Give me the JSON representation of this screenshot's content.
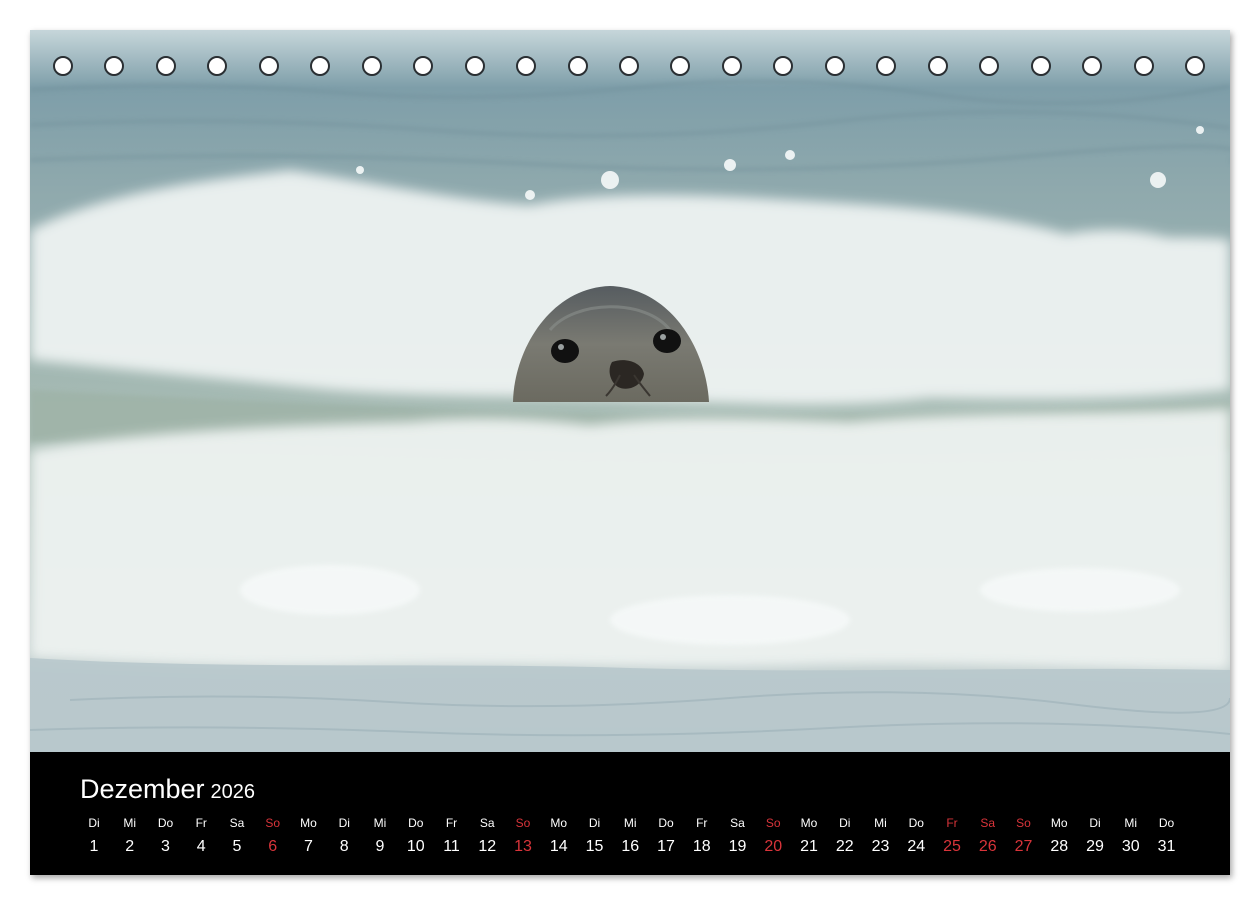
{
  "calendar": {
    "month": "Dezember",
    "year": "2026",
    "days": [
      {
        "dow": "Di",
        "num": "1",
        "red": false
      },
      {
        "dow": "Mi",
        "num": "2",
        "red": false
      },
      {
        "dow": "Do",
        "num": "3",
        "red": false
      },
      {
        "dow": "Fr",
        "num": "4",
        "red": false
      },
      {
        "dow": "Sa",
        "num": "5",
        "red": false
      },
      {
        "dow": "So",
        "num": "6",
        "red": true
      },
      {
        "dow": "Mo",
        "num": "7",
        "red": false
      },
      {
        "dow": "Di",
        "num": "8",
        "red": false
      },
      {
        "dow": "Mi",
        "num": "9",
        "red": false
      },
      {
        "dow": "Do",
        "num": "10",
        "red": false
      },
      {
        "dow": "Fr",
        "num": "11",
        "red": false
      },
      {
        "dow": "Sa",
        "num": "12",
        "red": false
      },
      {
        "dow": "So",
        "num": "13",
        "red": true
      },
      {
        "dow": "Mo",
        "num": "14",
        "red": false
      },
      {
        "dow": "Di",
        "num": "15",
        "red": false
      },
      {
        "dow": "Mi",
        "num": "16",
        "red": false
      },
      {
        "dow": "Do",
        "num": "17",
        "red": false
      },
      {
        "dow": "Fr",
        "num": "18",
        "red": false
      },
      {
        "dow": "Sa",
        "num": "19",
        "red": false
      },
      {
        "dow": "So",
        "num": "20",
        "red": true
      },
      {
        "dow": "Mo",
        "num": "21",
        "red": false
      },
      {
        "dow": "Di",
        "num": "22",
        "red": false
      },
      {
        "dow": "Mi",
        "num": "23",
        "red": false
      },
      {
        "dow": "Do",
        "num": "24",
        "red": false
      },
      {
        "dow": "Fr",
        "num": "25",
        "red": true
      },
      {
        "dow": "Sa",
        "num": "26",
        "red": true
      },
      {
        "dow": "So",
        "num": "27",
        "red": true
      },
      {
        "dow": "Mo",
        "num": "28",
        "red": false
      },
      {
        "dow": "Di",
        "num": "29",
        "red": false
      },
      {
        "dow": "Mi",
        "num": "30",
        "red": false
      },
      {
        "dow": "Do",
        "num": "31",
        "red": false
      }
    ]
  },
  "binding_holes": 23,
  "colors": {
    "calendar_background": "#000000",
    "calendar_text": "#ffffff",
    "holiday_text": "#d9343a",
    "sea": "#8fb0b8",
    "foam": "#eef3f2"
  }
}
